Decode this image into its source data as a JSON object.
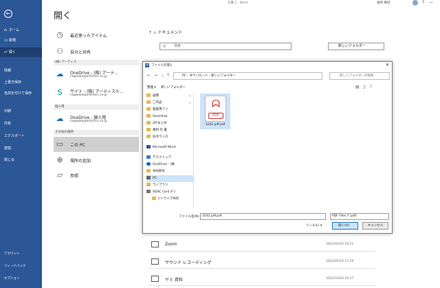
{
  "titlebar": {
    "title": "文書 1 - Word",
    "user": "長岡 真紀",
    "controls": [
      "?",
      "—",
      "□",
      "✕"
    ]
  },
  "rail": {
    "back": "←",
    "items": [
      {
        "label": "ホーム",
        "icon": "⌂"
      },
      {
        "label": "新規",
        "icon": "▭"
      },
      {
        "label": "開く",
        "icon": "▱"
      }
    ],
    "sub": [
      "情報",
      "上書き保存",
      "名前を付けて保存",
      "印刷",
      "共有",
      "エクスポート",
      "変換",
      "閉じる"
    ],
    "bottom": [
      "アカウント",
      "フィードバック",
      "オプション"
    ]
  },
  "page": {
    "title": "開く",
    "recent": "最近使ったアイテム",
    "shared": "自分と共有",
    "section_personal": "(株) アーティス",
    "onedrive_corp": {
      "name": "OneDrive - (株) アーテ…",
      "email": "nagaoka@artistics.co.jp"
    },
    "sites": {
      "name": "サイト - (株) アーティステ…",
      "email": "nagaoka@artistics.co.jp"
    },
    "section_personal2": "個人用",
    "onedrive_personal": {
      "name": "OneDrive - 個人用",
      "email": "nagaoka@artistics.co.jp"
    },
    "section_other": "その他の場所",
    "this_pc": "この PC",
    "add_place": "場所の追加",
    "browse": "参照"
  },
  "panel": {
    "crumb": "ドキュメント",
    "search_placeholder": "検索",
    "new_folder": "新しいフォルダー",
    "rows": [
      {
        "name": "Zoom",
        "date": "2022/05/10 19:21"
      },
      {
        "name": "サウンド レコーディング",
        "date": "2022/05/16 17:16"
      },
      {
        "name": "ヤミ 資料",
        "date": "2022/03/03 16:17"
      }
    ]
  },
  "dialog": {
    "title": "ファイルを開く",
    "address": "PC › ダウンロード › 新しいフォルダー",
    "search_placeholder": "新しいフォルダーの検索",
    "organize": "整理 ▾",
    "new_folder": "新しいフォルダー",
    "nav": [
      "画像",
      "ご作品",
      "家庭用ファ",
      "Soundrop",
      "ZIPまとめ",
      "素材 の 置",
      "旧ダウンロ",
      "Microsoft Word",
      "デスクトップ",
      "OneDrive - (株",
      "共同所有",
      "PC",
      "ライブラリ",
      "SDXC Card (F:)",
      "Cドライブ共有"
    ],
    "file_name": "3242.pdf.pdf",
    "file_label": "ファイル名(N):",
    "file_value": "3242.pdf.pdf",
    "file_type": "PDF Files (*.pdf)",
    "tools": "ツール(L) ▾",
    "open": "開く(O)",
    "cancel": "キャンセル",
    "pdf_tag": "PDF"
  }
}
